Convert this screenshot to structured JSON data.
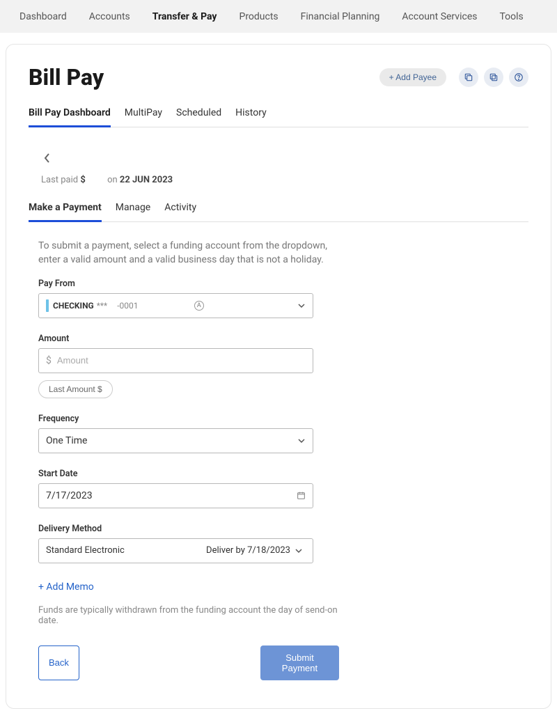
{
  "topnav": {
    "items": [
      "Dashboard",
      "Accounts",
      "Transfer & Pay",
      "Products",
      "Financial Planning",
      "Account Services",
      "Tools"
    ],
    "active": 2
  },
  "header": {
    "title": "Bill Pay",
    "add_payee": "+ Add Payee"
  },
  "tabs1": {
    "items": [
      "Bill Pay Dashboard",
      "MultiPay",
      "Scheduled",
      "History"
    ],
    "active": 0
  },
  "lastpaid": {
    "label": "Last paid",
    "amount": "$",
    "on_prefix": "on",
    "date": "22 JUN 2023"
  },
  "tabs2": {
    "items": [
      "Make a Payment",
      "Manage",
      "Activity"
    ],
    "active": 0
  },
  "form": {
    "instructions": "To submit a payment, select a funding account from the dropdown, enter a valid amount and a valid business day that is not a holiday.",
    "pay_from": {
      "label": "Pay From",
      "account_name": "CHECKING",
      "stars": "***",
      "last4": "-0001",
      "badge": "A"
    },
    "amount": {
      "label": "Amount",
      "currency": "$",
      "placeholder": "Amount",
      "last_amount_label": "Last Amount $"
    },
    "frequency": {
      "label": "Frequency",
      "value": "One Time"
    },
    "start_date": {
      "label": "Start Date",
      "value": "7/17/2023"
    },
    "delivery": {
      "label": "Delivery Method",
      "method": "Standard Electronic",
      "deliver_by": "Deliver by 7/18/2023"
    },
    "add_memo": "+ Add Memo",
    "withdraw_note": "Funds are typically withdrawn from the funding account the day of send-on date.",
    "back": "Back",
    "submit": "Submit Payment"
  }
}
